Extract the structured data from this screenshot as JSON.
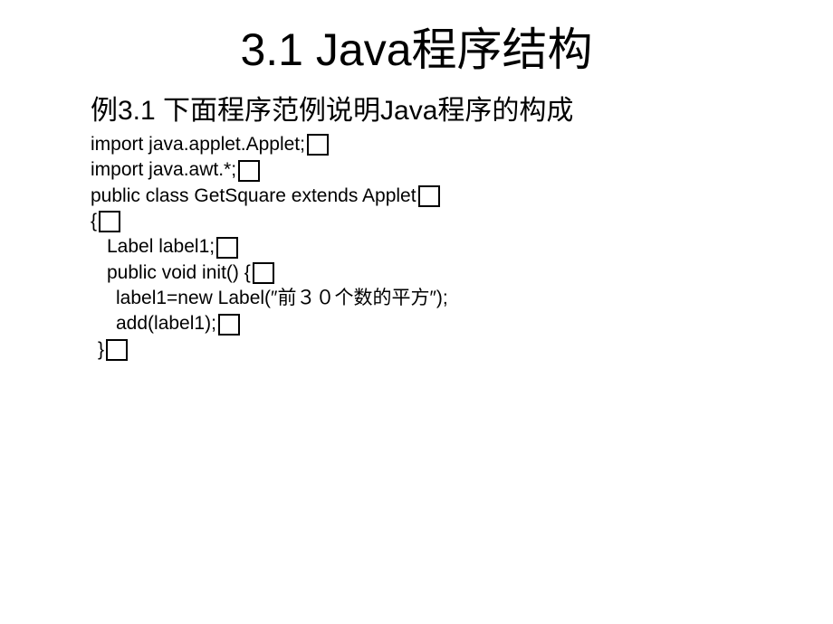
{
  "title": "3.1 Java程序结构",
  "subtitle": "例3.1 下面程序范例说明Java程序的构成",
  "code": {
    "line1": "import java.applet.Applet;",
    "line2": "import java.awt.*;",
    "line3": "public class GetSquare extends Applet",
    "line4": "{",
    "line5": "Label label1;",
    "line6": "public void init() {",
    "line7": "label1=new Label(″前３０个数的平方″);",
    "line8": "add(label1);",
    "line9": "}"
  }
}
